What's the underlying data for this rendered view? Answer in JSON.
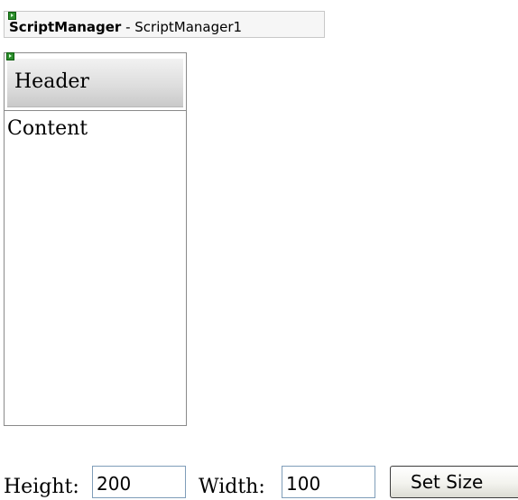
{
  "script_manager": {
    "type_name": "ScriptManager",
    "separator": " - ",
    "instance_id": "ScriptManager1"
  },
  "panel": {
    "header_text": "Header",
    "content_text": "Content"
  },
  "controls": {
    "height_label": "Height:",
    "height_value": "200",
    "width_label": "Width:",
    "width_value": "100",
    "set_size_label": "Set Size"
  }
}
